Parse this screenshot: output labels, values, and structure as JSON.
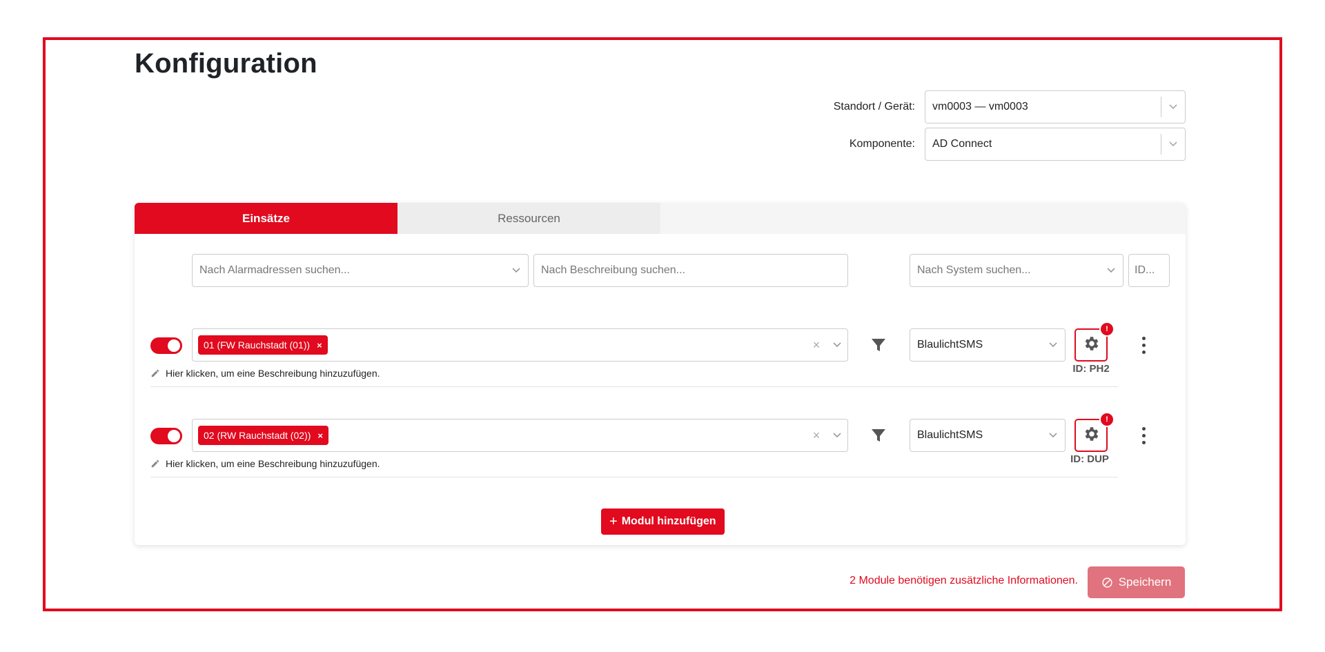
{
  "page": {
    "title": "Konfiguration"
  },
  "location": {
    "label": "Standort / Gerät:",
    "value": "vm0003 — vm0003"
  },
  "component": {
    "label": "Komponente:",
    "value": "AD Connect"
  },
  "tabs": [
    {
      "label": "Einsätze",
      "active": true
    },
    {
      "label": "Ressourcen",
      "active": false
    }
  ],
  "filters": {
    "alarm_placeholder": "Nach Alarmadressen suchen...",
    "description_placeholder": "Nach Beschreibung suchen...",
    "system_placeholder": "Nach System suchen...",
    "id_placeholder": "ID..."
  },
  "modules": [
    {
      "enabled": true,
      "tag": "01 (FW Rauchstadt (01))",
      "system": "BlaulichtSMS",
      "badge": "!",
      "id_label": "ID: PH2",
      "description": "Hier klicken, um eine Beschreibung hinzuzufügen."
    },
    {
      "enabled": true,
      "tag": "02 (RW Rauchstadt (02))",
      "system": "BlaulichtSMS",
      "badge": "!",
      "id_label": "ID: DUP",
      "description": "Hier klicken, um eine Beschreibung hinzuzufügen."
    }
  ],
  "tag_remove": "×",
  "clear_symbol": "×",
  "actions": {
    "add_plus": "+",
    "add_module": "Modul hinzufügen",
    "notice": "2 Module benötigen zusätzliche Informationen.",
    "save": "Speichern"
  },
  "colors": {
    "accent": "#e10a1e",
    "save_disabled": "#e0737e",
    "tab_inactive": "#ededed"
  },
  "icons": [
    "chevron-down-icon",
    "filter-icon",
    "gear-icon",
    "kebab-icon",
    "pencil-icon",
    "ban-icon"
  ]
}
